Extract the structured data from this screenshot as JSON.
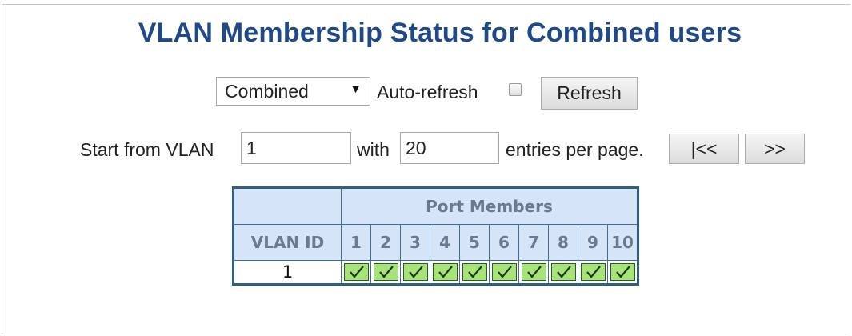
{
  "title": "VLAN Membership Status for Combined users",
  "controls": {
    "user_select": {
      "selected": "Combined"
    },
    "auto_refresh_label": "Auto-refresh",
    "auto_refresh_checked": false,
    "refresh_label": "Refresh"
  },
  "paging": {
    "start_label": "Start from VLAN",
    "start_value": "1",
    "with_label": "with",
    "entries_value": "20",
    "entries_label": "entries per page.",
    "first_label": "|<<",
    "next_label": ">>"
  },
  "table": {
    "group_header": "Port Members",
    "vlan_id_header": "VLAN ID",
    "ports": [
      "1",
      "2",
      "3",
      "4",
      "5",
      "6",
      "7",
      "8",
      "9",
      "10"
    ],
    "rows": [
      {
        "vlan_id": "1",
        "members": [
          true,
          true,
          true,
          true,
          true,
          true,
          true,
          true,
          true,
          true
        ]
      }
    ]
  },
  "colors": {
    "title": "#1f4a87",
    "header_bg": "#d5e4f6",
    "border": "#2e5f86",
    "member": "#a6e47a"
  }
}
